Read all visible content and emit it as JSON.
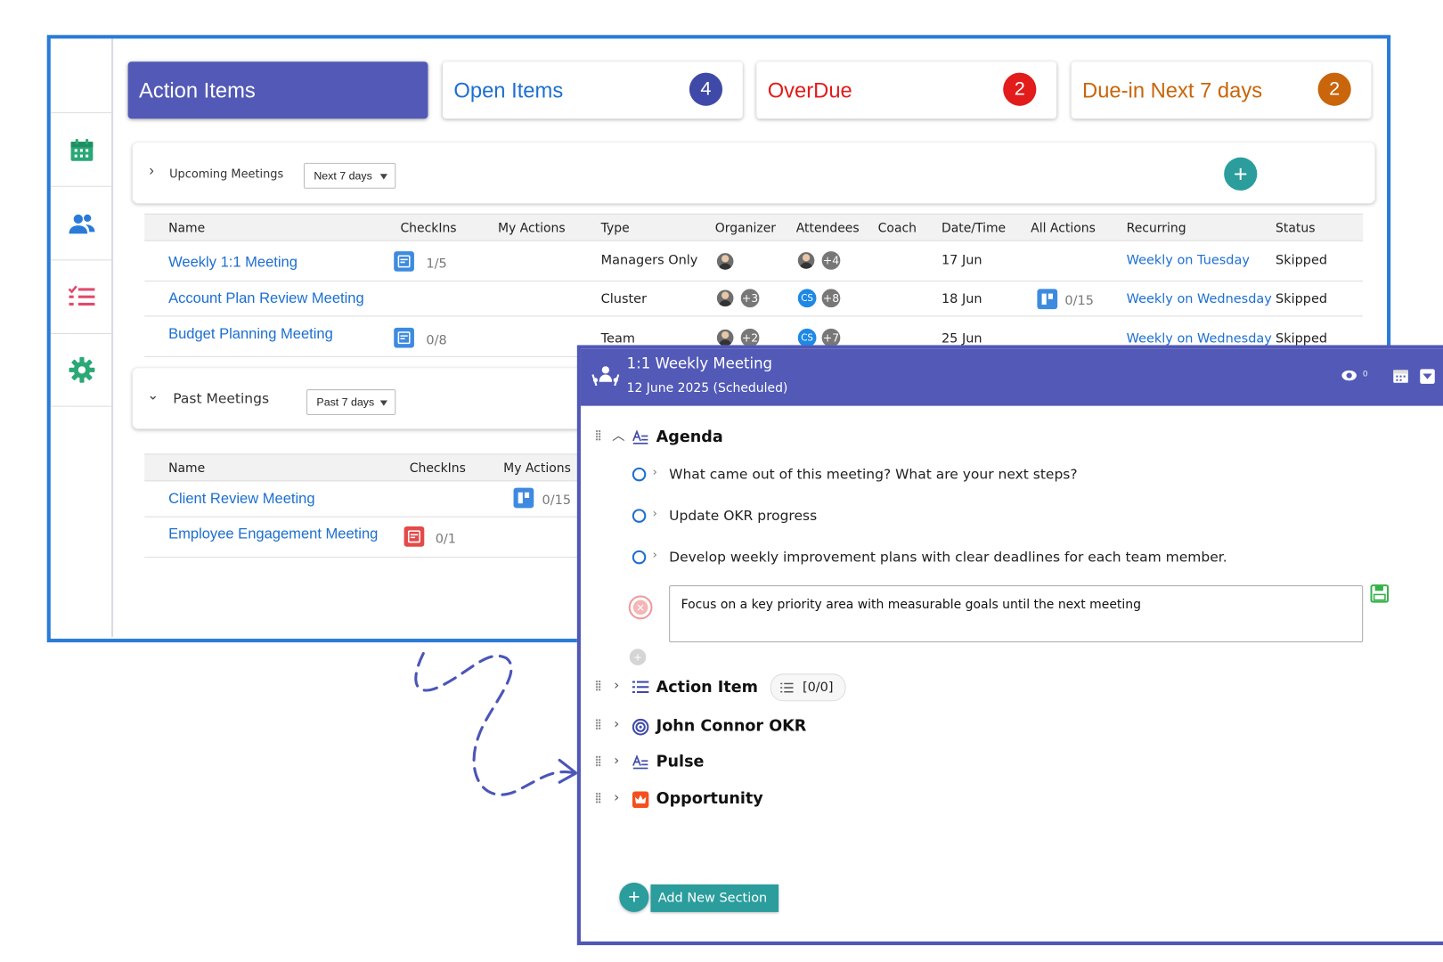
{
  "cards": {
    "action_items": {
      "label": "Action Items"
    },
    "open_items": {
      "label": "Open Items",
      "count": "4"
    },
    "overdue": {
      "label": "OverDue",
      "count": "2"
    },
    "due_next": {
      "label": "Due-in Next 7 days",
      "count": "2"
    }
  },
  "upcoming": {
    "title": "Upcoming Meetings",
    "filter": "Next 7 days",
    "columns": [
      "Name",
      "CheckIns",
      "My Actions",
      "Type",
      "Organizer",
      "Attendees",
      "Coach",
      "Date/Time",
      "All Actions",
      "Recurring",
      "Status"
    ],
    "rows": [
      {
        "name": "Weekly 1:1 Meeting",
        "checkins": "1/5",
        "type": "Managers Only",
        "organizer_more": "",
        "attendees_more": "+4",
        "date": "17 Jun",
        "all_actions": "",
        "recurring": "Weekly on Tuesday",
        "status": "Skipped"
      },
      {
        "name": "Account Plan Review Meeting",
        "checkins": "",
        "type": "Cluster",
        "organizer_more": "+3",
        "attendees_cs": "CS",
        "attendees_more": "+8",
        "date": "18 Jun",
        "all_actions": "0/15",
        "recurring": "Weekly on Wednesday",
        "status": "Skipped"
      },
      {
        "name": "Budget Planning Meeting",
        "checkins": "0/8",
        "type": "Team",
        "organizer_more": "+2",
        "attendees_cs": "CS",
        "attendees_more": "+7",
        "date": "25 Jun",
        "all_actions": "",
        "recurring": "Weekly on Wednesday",
        "status": "Skipped"
      }
    ]
  },
  "past": {
    "title": "Past Meetings",
    "filter": "Past 7 days",
    "columns": [
      "Name",
      "CheckIns",
      "My Actions"
    ],
    "rows": [
      {
        "name": "Client Review Meeting",
        "checkins": "",
        "my_actions": "0/15"
      },
      {
        "name": "Employee Engagement Meeting",
        "checkins": "0/1",
        "my_actions": ""
      }
    ]
  },
  "meeting": {
    "title": "1:1 Weekly Meeting",
    "subtitle": "12 June 2025 (Scheduled)",
    "visibility_count": "0",
    "agenda": {
      "title": "Agenda",
      "items": [
        "What came out of this meeting? What are your next steps?",
        "Update OKR progress",
        "Develop weekly improvement plans with clear deadlines for each team member."
      ],
      "draft": "Focus on a key priority area with measurable goals until the next meeting"
    },
    "sections": [
      {
        "title": "Action Item",
        "badge": "[0/0]"
      },
      {
        "title": "John Connor OKR"
      },
      {
        "title": "Pulse"
      },
      {
        "title": "Opportunity"
      }
    ],
    "add_section": "Add New Section"
  },
  "colors": {
    "primary": "#5259b6",
    "accent_teal": "#2a9d9c",
    "overdue_red": "#e21b1b",
    "due_orange": "#c9650a",
    "link_blue": "#1c6fd1",
    "frame_blue": "#2a7bd8"
  },
  "icons": [
    "calendar-icon",
    "people-icon",
    "checklist-icon",
    "gear-icon",
    "plus-icon",
    "chevron-right-icon",
    "chevron-down-icon",
    "checkin-icon",
    "board-icon",
    "meeting-logo-icon",
    "visibility-icon",
    "calendar-small-icon",
    "dropdown-arrow-icon",
    "list-icon",
    "target-icon",
    "crown-icon",
    "save-icon",
    "cancel-icon"
  ]
}
